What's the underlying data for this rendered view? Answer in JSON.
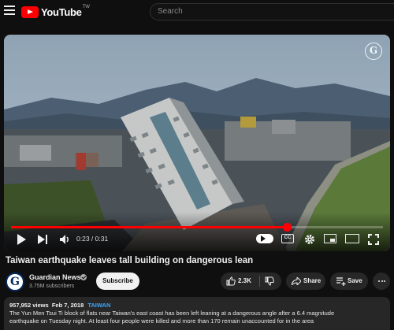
{
  "header": {
    "logo_text": "YouTube",
    "region": "TW",
    "search_placeholder": "Search"
  },
  "player": {
    "watermark": "G",
    "current_time": "0:23",
    "duration": "0:31",
    "time_separator": " / ",
    "progress_fraction": 0.742,
    "buffered_fraction": 0.74,
    "cc_label": "CC"
  },
  "video": {
    "title": "Taiwan earthquake leaves tall building on dangerous lean"
  },
  "channel": {
    "avatar_letter": "G",
    "name": "Guardian News",
    "subscribers": "3.75M subscribers",
    "subscribe_label": "Subscribe"
  },
  "actions": {
    "like_count": "2.3K",
    "share_label": "Share",
    "save_label": "Save"
  },
  "description": {
    "views": "957,952 views",
    "date": "Feb 7, 2018",
    "tag": "TAIWAN",
    "line1": "The Yun Men Tsui Ti block of flats near Taiwan's east coast has been left leaning at a dangerous angle after a 6.4 magnitude",
    "line2": "earthquake on Tuesday night. At least four people were killed and more than 170 remain unaccounted for in the area"
  },
  "colors": {
    "background": "#0f0f0f",
    "accent_red": "#ff0000",
    "link_blue": "#3ea6ff",
    "pill": "#272727"
  }
}
